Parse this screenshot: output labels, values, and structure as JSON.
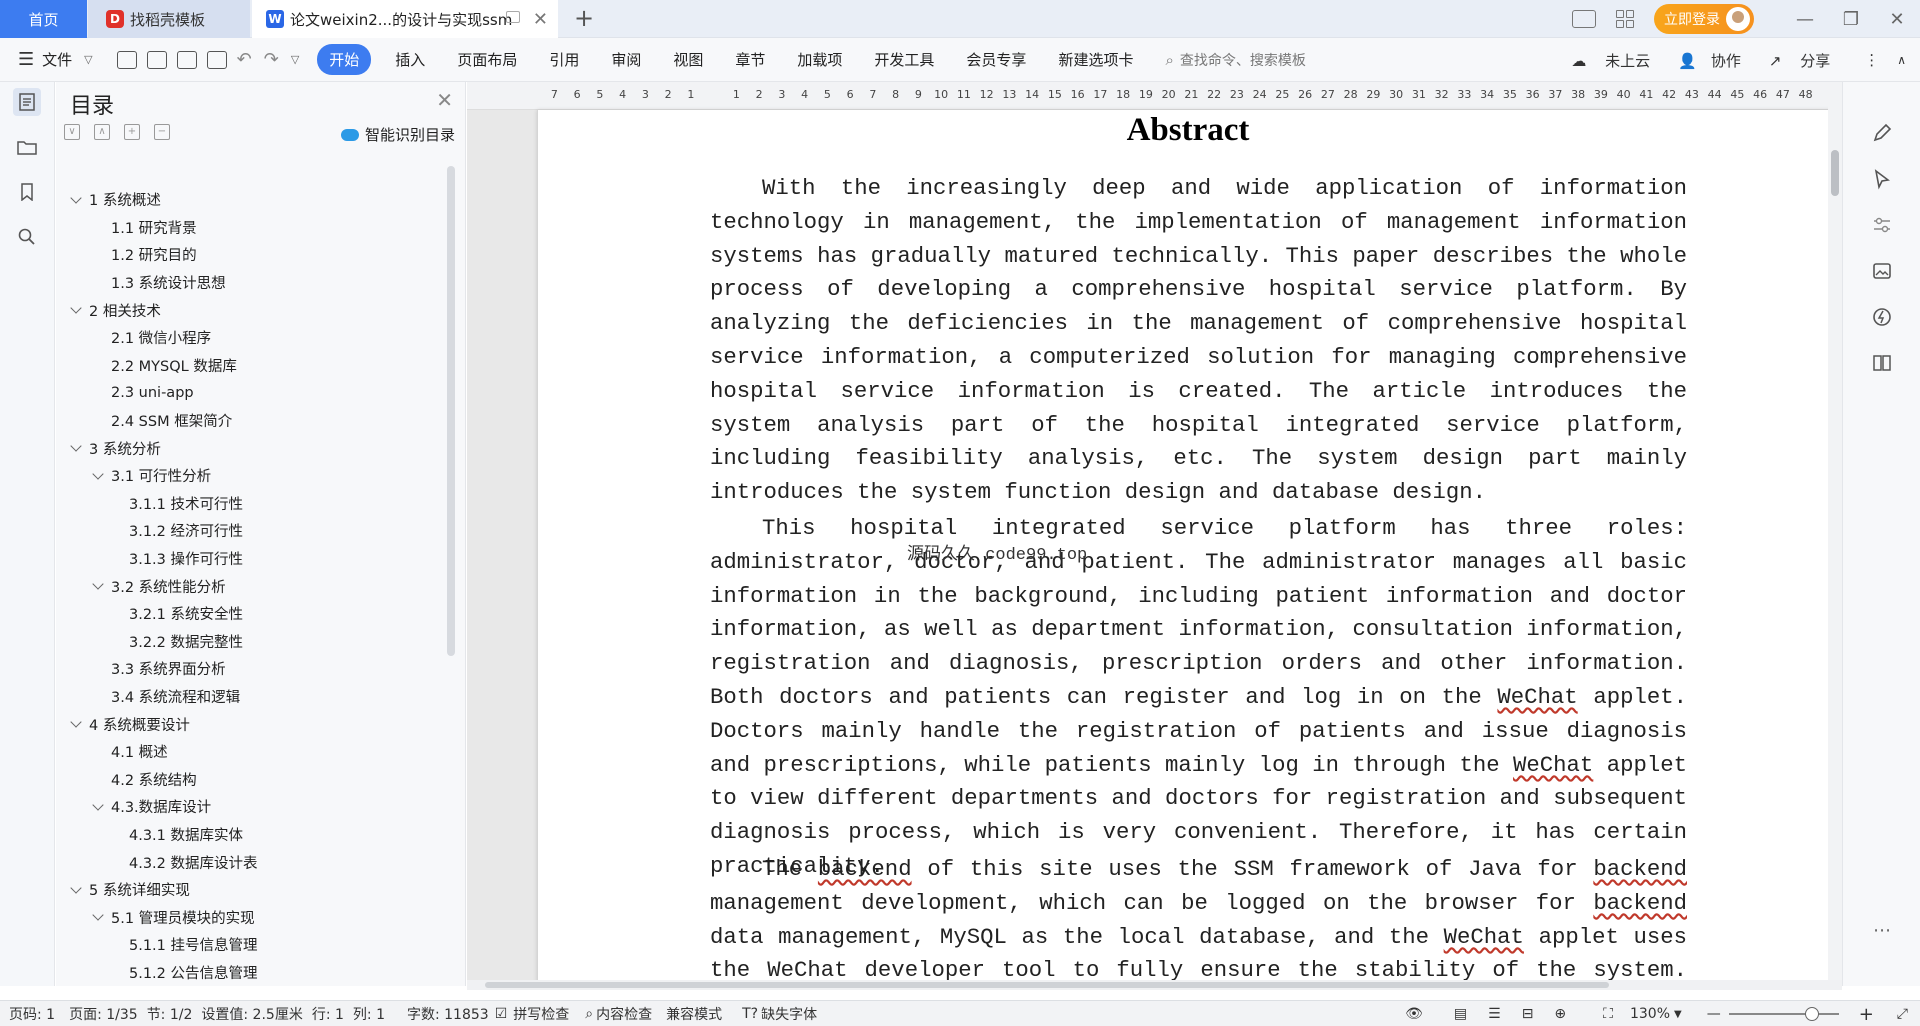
{
  "tabs": {
    "home": "首页",
    "template": "找稻壳模板",
    "document": "论文weixin2...的设计与实现ssm",
    "login": "立即登录"
  },
  "ribbon": {
    "file": "文件",
    "items": [
      "开始",
      "插入",
      "页面布局",
      "引用",
      "审阅",
      "视图",
      "章节",
      "加载项",
      "开发工具",
      "会员专享",
      "新建选项卡"
    ],
    "search_placeholder": "查找命令、搜索模板",
    "cloud": "未上云",
    "collab": "协作",
    "share": "分享"
  },
  "toc": {
    "title": "目录",
    "smart": "智能识别目录",
    "items": [
      {
        "label": "1 系统概述",
        "level": 1,
        "chev": true
      },
      {
        "label": "1.1  研究背景",
        "level": 2,
        "chev": false
      },
      {
        "label": "1.2 研究目的",
        "level": 2,
        "chev": false
      },
      {
        "label": "1.3 系统设计思想",
        "level": 2,
        "chev": false
      },
      {
        "label": "2 相关技术",
        "level": 1,
        "chev": true
      },
      {
        "label": "2.1 微信小程序",
        "level": 2,
        "chev": false
      },
      {
        "label": "2.2 MYSQL 数据库",
        "level": 2,
        "chev": false
      },
      {
        "label": "2.3 uni-app",
        "level": 2,
        "chev": false
      },
      {
        "label": "2.4 SSM 框架简介",
        "level": 2,
        "chev": false
      },
      {
        "label": "3 系统分析",
        "level": 1,
        "chev": true
      },
      {
        "label": "3.1 可行性分析",
        "level": 2,
        "chev": true
      },
      {
        "label": "3.1.1 技术可行性",
        "level": 3,
        "chev": false
      },
      {
        "label": "3.1.2 经济可行性",
        "level": 3,
        "chev": false
      },
      {
        "label": "3.1.3 操作可行性",
        "level": 3,
        "chev": false
      },
      {
        "label": "3.2 系统性能分析",
        "level": 2,
        "chev": true
      },
      {
        "label": "3.2.1  系统安全性",
        "level": 3,
        "chev": false
      },
      {
        "label": "3.2.2  数据完整性",
        "level": 3,
        "chev": false
      },
      {
        "label": "3.3 系统界面分析",
        "level": 2,
        "chev": false
      },
      {
        "label": "3.4 系统流程和逻辑",
        "level": 2,
        "chev": false
      },
      {
        "label": "4 系统概要设计",
        "level": 1,
        "chev": true
      },
      {
        "label": "4.1 概述",
        "level": 2,
        "chev": false
      },
      {
        "label": "4.2 系统结构",
        "level": 2,
        "chev": false
      },
      {
        "label": "4.3.数据库设计",
        "level": 2,
        "chev": true
      },
      {
        "label": "4.3.1 数据库实体",
        "level": 3,
        "chev": false
      },
      {
        "label": "4.3.2 数据库设计表",
        "level": 3,
        "chev": false
      },
      {
        "label": "5 系统详细实现",
        "level": 1,
        "chev": true
      },
      {
        "label": "5.1  管理员模块的实现",
        "level": 2,
        "chev": true
      },
      {
        "label": "5.1.1  挂号信息管理",
        "level": 3,
        "chev": false
      },
      {
        "label": "5.1.2  公告信息管理",
        "level": 3,
        "chev": false
      }
    ]
  },
  "ruler": [
    "7",
    "6",
    "5",
    "4",
    "3",
    "2",
    "1",
    "",
    "1",
    "2",
    "3",
    "4",
    "5",
    "6",
    "7",
    "8",
    "9",
    "10",
    "11",
    "12",
    "13",
    "14",
    "15",
    "16",
    "17",
    "18",
    "19",
    "20",
    "21",
    "22",
    "23",
    "24",
    "25",
    "26",
    "27",
    "28",
    "29",
    "30",
    "31",
    "32",
    "33",
    "34",
    "35",
    "36",
    "37",
    "38",
    "39",
    "40",
    "41",
    "42",
    "43",
    "44",
    "45",
    "46",
    "47",
    "48"
  ],
  "document": {
    "heading": "Abstract",
    "watermark": "源码久久 code99.top",
    "p1": "With the increasingly deep and wide application of information technology in management, the implementation of management information systems has gradually matured technically. This paper describes the whole process of developing a comprehensive hospital service platform. By analyzing the deficiencies in the management of comprehensive hospital service information, a computerized solution for managing comprehensive hospital service information is created. The article introduces the system analysis part of the hospital integrated service platform, including feasibility analysis, etc. The system design part mainly introduces the system function design and database design.",
    "p2a": "This hospital integrated service platform has three roles: administrator, doctor, and patient. The administrator manages all basic information in the background, including patient information and doctor information, as well as department information, consultation information, registration and diagnosis, prescription orders and other information. Both doctors and patients can register and log in on the ",
    "p2b": "WeChat",
    "p2c": " applet. Doctors mainly handle the registration of patients and issue diagnosis and prescriptions, while patients mainly log in through the ",
    "p2d": "WeChat",
    "p2e": " applet to view different departments and doctors for registration and subsequent diagnosis process, which is very convenient. Therefore, it has certain practicality.",
    "p3a": "The ",
    "p3b": "backend",
    "p3c": " of this site uses the SSM framework of Java for ",
    "p3d": "backend",
    "p3e": " management development, which can be logged on the browser for ",
    "p3f": "backend",
    "p3g": " data management, MySQL as the local database, and the ",
    "p3h": "WeChat",
    "p3i": " applet uses the ",
    "p3j": "WeChat",
    "p3k": " developer tool to fully ensure the stability of the system. The system has a"
  },
  "status": {
    "page_code": "页码: 1",
    "page": "页面: 1/35",
    "section": "节: 1/2",
    "setting": "设置值: 2.5厘米",
    "row": "行: 1",
    "col": "列: 1",
    "words": "字数: 11853",
    "spell": "拼写检查",
    "content_check": "内容检查",
    "compat": "兼容模式",
    "missing_font": "缺失字体",
    "zoom": "130%",
    "zoom_fraction": 0.76
  }
}
